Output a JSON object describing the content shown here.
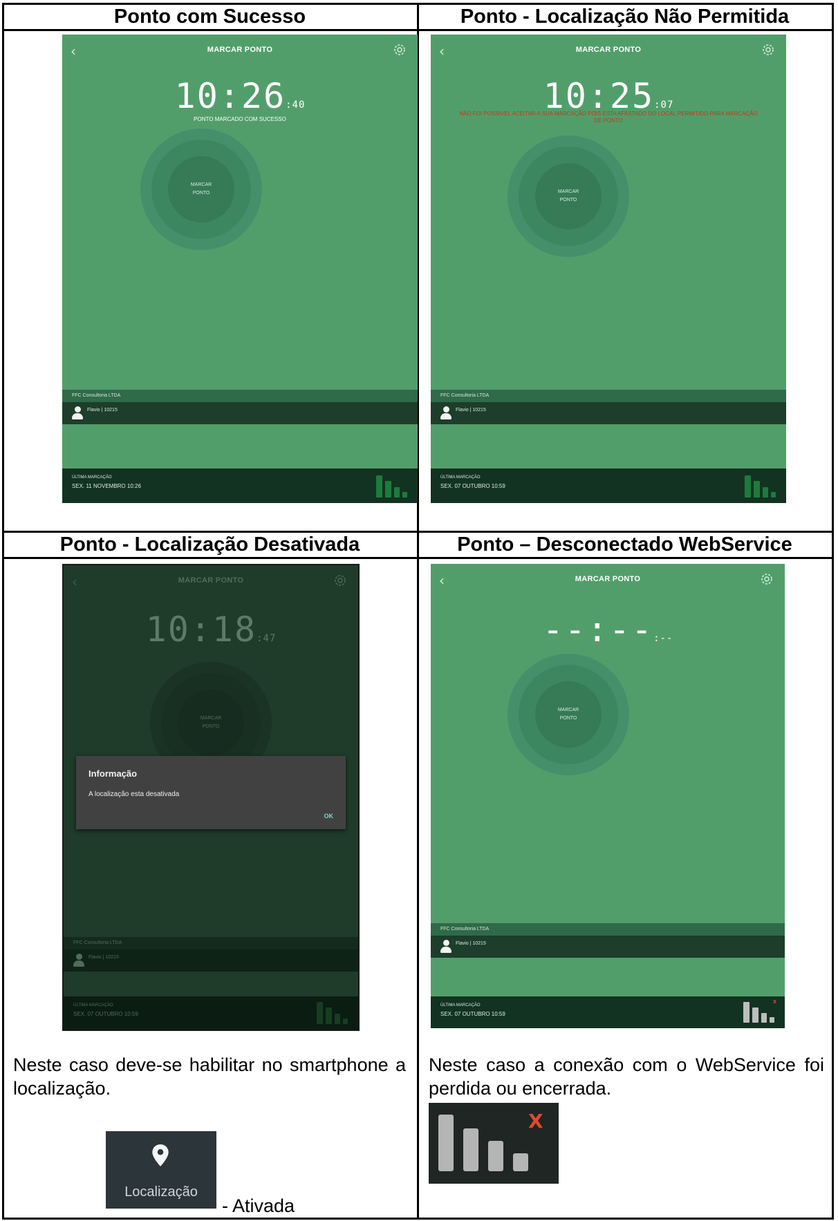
{
  "cells": [
    {
      "title": "Ponto com Sucesso",
      "screen": {
        "header_title": "MARCAR PONTO",
        "clock_main": "10:26",
        "clock_seconds": ":40",
        "message": "PONTO MARCADO COM SUCESSO",
        "button_line1": "MARCAR",
        "button_line2": "PONTO",
        "company": "FFC Consultoria LTDA",
        "user": "Flavio | 10215",
        "last_label": "ÚLTIMA MARCAÇÃO",
        "last_value": "SEX. 11 NOVEMBRO 10:26"
      }
    },
    {
      "title": "Ponto - Localização Não Permitida",
      "screen": {
        "header_title": "MARCAR PONTO",
        "clock_main": "10:25",
        "clock_seconds": ":07",
        "message": "NÃO FOI POSSIVEL ACEITAR A SUA MARCAÇÃO POIS ESTA AFASTADO DO LOCAL PERMITIDO PARA MARCAÇÃO DE PONTO",
        "button_line1": "MARCAR",
        "button_line2": "PONTO",
        "company": "FFC Consultoria LTDA",
        "user": "Flavio | 10215",
        "last_label": "ÚLTIMA MARCAÇÃO",
        "last_value": "SEX. 07 OUTUBRO 10:59"
      }
    },
    {
      "title": "Ponto - Localização Desativada",
      "screen": {
        "header_title": "MARCAR PONTO",
        "clock_main": "10:18",
        "clock_seconds": ":47",
        "button_line1": "MARCAR",
        "button_line2": "PONTO",
        "company": "FFC Consultoria LTDA",
        "user": "Flavio | 10215",
        "last_label": "ÚLTIMA MARCAÇÃO",
        "last_value": "SEX. 07 OUTUBRO 10:59",
        "dialog_title": "Informação",
        "dialog_text": "A localização esta desativada",
        "dialog_ok": "OK"
      },
      "note": "Neste caso deve-se habilitar no smartphone a localização.",
      "tile_label": "Localização",
      "tile_suffix": "- Ativada"
    },
    {
      "title": "Ponto – Desconectado WebService",
      "screen": {
        "header_title": "MARCAR PONTO",
        "clock_main": "--:--",
        "clock_seconds": ":--",
        "button_line1": "MARCAR",
        "button_line2": "PONTO",
        "company": "FFC Consultoria LTDA",
        "user": "Flavio | 10215",
        "last_label": "ÚLTIMA MARCAÇÃO",
        "last_value": "SEX. 07 OUTUBRO 10:59",
        "signal_x": "x"
      },
      "note": "Neste caso a conexão com o WebService foi perdida ou encerrada.",
      "tile_x": "X"
    }
  ],
  "colors": {
    "screen_green": "#529e6b",
    "error_red": "#c03a1c",
    "signal_green": "#1f7a3e",
    "dialog_bg": "#414141"
  },
  "icons": [
    "back-chevron-icon",
    "gear-icon",
    "user-avatar-icon",
    "signal-bars-icon",
    "location-pin-icon"
  ]
}
